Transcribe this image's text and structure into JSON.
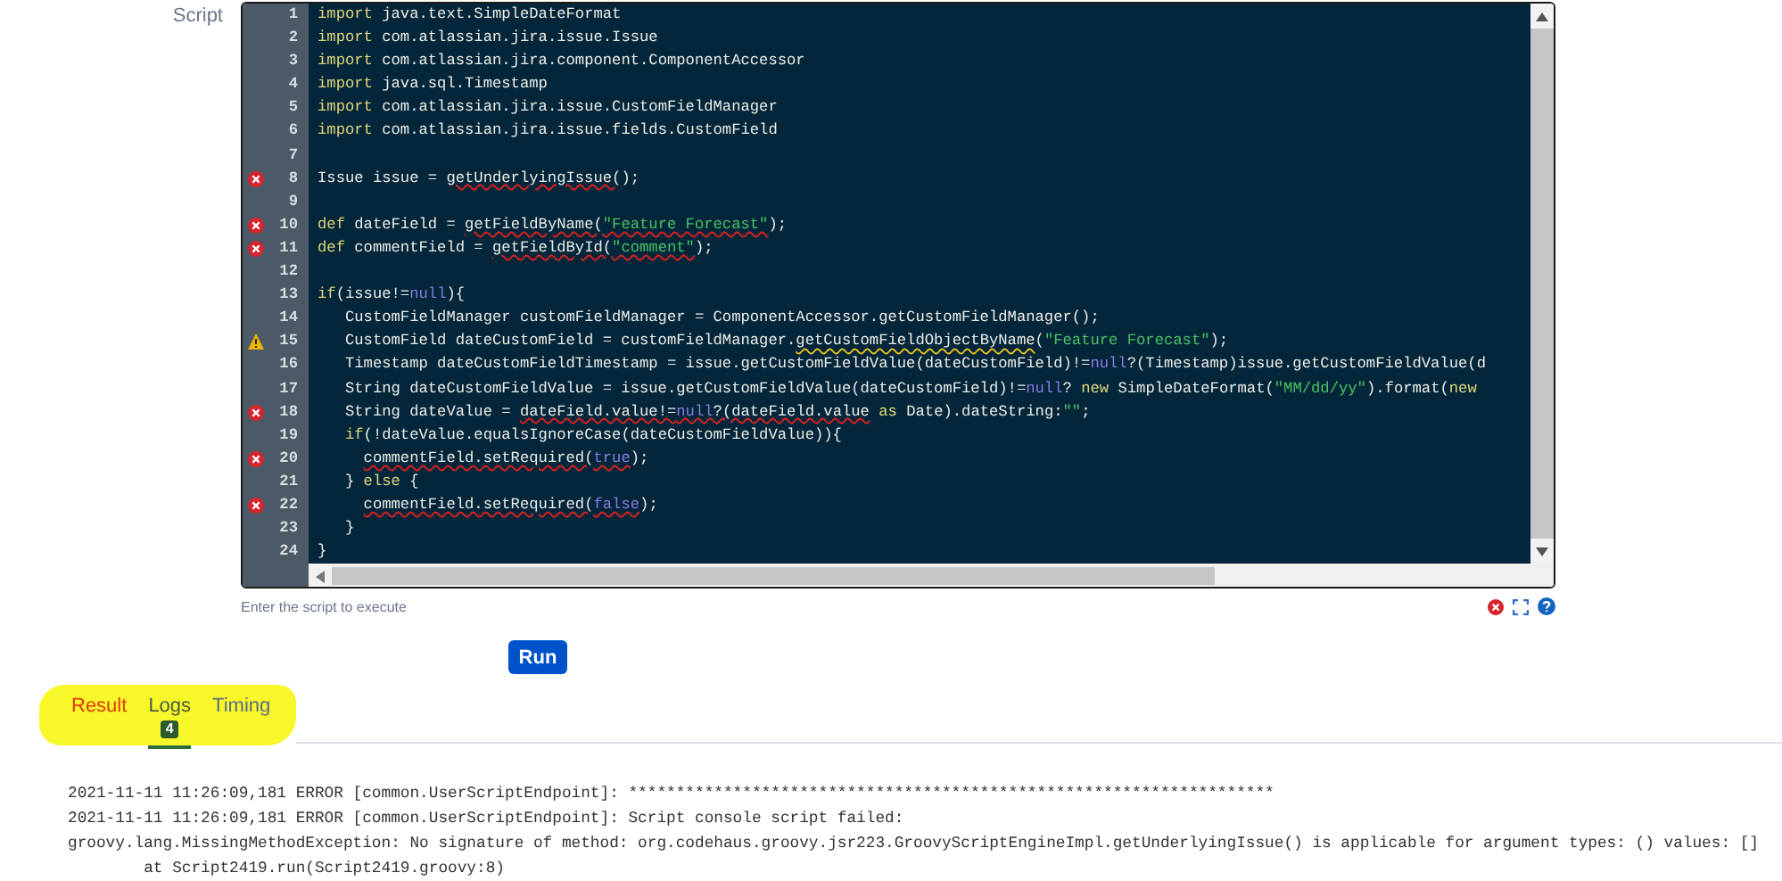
{
  "script_label": "Script",
  "editor": {
    "lines": [
      {
        "number": "1",
        "error": false,
        "warning": false,
        "tokens": [
          {
            "kind": "keyword",
            "text": "import"
          },
          {
            "kind": "plain",
            "text": " java.text.SimpleDateFormat"
          }
        ]
      },
      {
        "number": "2",
        "error": false,
        "warning": false,
        "tokens": [
          {
            "kind": "keyword",
            "text": "import"
          },
          {
            "kind": "plain",
            "text": " com.atlassian.jira.issue.Issue"
          }
        ]
      },
      {
        "number": "3",
        "error": false,
        "warning": false,
        "tokens": [
          {
            "kind": "keyword",
            "text": "import"
          },
          {
            "kind": "plain",
            "text": " com.atlassian.jira.component.ComponentAccessor"
          }
        ]
      },
      {
        "number": "4",
        "error": false,
        "warning": false,
        "tokens": [
          {
            "kind": "keyword",
            "text": "import"
          },
          {
            "kind": "plain",
            "text": " java.sql.Timestamp"
          }
        ]
      },
      {
        "number": "5",
        "error": false,
        "warning": false,
        "tokens": [
          {
            "kind": "keyword",
            "text": "import"
          },
          {
            "kind": "plain",
            "text": " com.atlassian.jira.issue.CustomFieldManager"
          }
        ]
      },
      {
        "number": "6",
        "error": false,
        "warning": false,
        "tokens": [
          {
            "kind": "keyword",
            "text": "import"
          },
          {
            "kind": "plain",
            "text": " com.atlassian.jira.issue.fields.CustomField"
          }
        ]
      },
      {
        "number": "7",
        "error": false,
        "warning": false
      },
      {
        "number": "8",
        "error": true,
        "warning": false,
        "tokens": [
          {
            "kind": "plain",
            "text": "Issue issue = "
          },
          {
            "kind": "plain",
            "text": "getUnderlyingIssue(",
            "error": true
          },
          {
            "kind": "plain",
            "text": ");"
          }
        ]
      },
      {
        "number": "9",
        "error": false,
        "warning": false
      },
      {
        "number": "10",
        "error": true,
        "warning": false,
        "tokens": [
          {
            "kind": "keyword",
            "text": "def"
          },
          {
            "kind": "plain",
            "text": " dateField = "
          },
          {
            "kind": "plain",
            "text": "getFieldByName(",
            "error": true
          },
          {
            "kind": "string",
            "text": "\"Feature Forecast\"",
            "error": true
          },
          {
            "kind": "plain",
            "text": ");"
          }
        ]
      },
      {
        "number": "11",
        "error": true,
        "warning": false,
        "tokens": [
          {
            "kind": "keyword",
            "text": "def"
          },
          {
            "kind": "plain",
            "text": " commentField = "
          },
          {
            "kind": "plain",
            "text": "getFieldById(",
            "error": true
          },
          {
            "kind": "string",
            "text": "\"comment\"",
            "error": true
          },
          {
            "kind": "plain",
            "text": ");"
          }
        ]
      },
      {
        "number": "12",
        "error": false,
        "warning": false
      },
      {
        "number": "13",
        "error": false,
        "warning": false,
        "tokens": [
          {
            "kind": "keyword",
            "text": "if"
          },
          {
            "kind": "plain",
            "text": "(issue!="
          },
          {
            "kind": "literal",
            "text": "null"
          },
          {
            "kind": "plain",
            "text": "){"
          }
        ]
      },
      {
        "number": "14",
        "error": false,
        "warning": false,
        "tokens": [
          {
            "kind": "plain",
            "text": "   CustomFieldManager customFieldManager = ComponentAccessor.getCustomFieldManager();"
          }
        ]
      },
      {
        "number": "15",
        "error": false,
        "warning": true,
        "tokens": [
          {
            "kind": "plain",
            "text": "   CustomField dateCustomField = customFieldManager."
          },
          {
            "kind": "plain",
            "text": "getCustomFieldObjectByName",
            "warning": true
          },
          {
            "kind": "plain",
            "text": "("
          },
          {
            "kind": "string",
            "text": "\"Feature Forecast\""
          },
          {
            "kind": "plain",
            "text": ");"
          }
        ]
      },
      {
        "number": "16",
        "error": false,
        "warning": false,
        "tokens": [
          {
            "kind": "plain",
            "text": "   Timestamp dateCustomFieldTimestamp = issue.getCustomFieldValue(dateCustomField)!="
          },
          {
            "kind": "literal",
            "text": "null"
          },
          {
            "kind": "plain",
            "text": "?(Timestamp)issue.getCustomFieldValue(d"
          }
        ]
      },
      {
        "number": "17",
        "error": false,
        "warning": false,
        "tokens": [
          {
            "kind": "plain",
            "text": "   String dateCustomFieldValue = issue.getCustomFieldValue(dateCustomField)!="
          },
          {
            "kind": "literal",
            "text": "null"
          },
          {
            "kind": "plain",
            "text": "? "
          },
          {
            "kind": "keyword",
            "text": "new"
          },
          {
            "kind": "plain",
            "text": " SimpleDateFormat("
          },
          {
            "kind": "string",
            "text": "\"MM/dd/yy\""
          },
          {
            "kind": "plain",
            "text": ").format("
          },
          {
            "kind": "keyword",
            "text": "new"
          }
        ]
      },
      {
        "number": "18",
        "error": true,
        "warning": false,
        "tokens": [
          {
            "kind": "plain",
            "text": "   String dateValue = "
          },
          {
            "kind": "plain",
            "text": "dateField.value!=",
            "error": true
          },
          {
            "kind": "literal",
            "text": "null",
            "error": true
          },
          {
            "kind": "plain",
            "text": "?(dateField.value",
            "error": true
          },
          {
            "kind": "keyword",
            "text": " as"
          },
          {
            "kind": "plain",
            "text": " Date).dateString:"
          },
          {
            "kind": "string",
            "text": "\"\""
          },
          {
            "kind": "plain",
            "text": ";"
          }
        ]
      },
      {
        "number": "19",
        "error": false,
        "warning": false,
        "tokens": [
          {
            "kind": "keyword",
            "text": "   if"
          },
          {
            "kind": "plain",
            "text": "(!dateValue.equalsIgnoreCase(dateCustomFieldValue)){"
          }
        ]
      },
      {
        "number": "20",
        "error": true,
        "warning": false,
        "tokens": [
          {
            "kind": "plain",
            "text": "     commentField.setRequired(",
            "error": true
          },
          {
            "kind": "literal",
            "text": "true",
            "error": true
          },
          {
            "kind": "plain",
            "text": ");"
          }
        ]
      },
      {
        "number": "21",
        "error": false,
        "warning": false,
        "tokens": [
          {
            "kind": "plain",
            "text": "   } "
          },
          {
            "kind": "keyword",
            "text": "else"
          },
          {
            "kind": "plain",
            "text": " {"
          }
        ]
      },
      {
        "number": "22",
        "error": true,
        "warning": false,
        "tokens": [
          {
            "kind": "plain",
            "text": "     commentField.setRequired(",
            "error": true
          },
          {
            "kind": "literal",
            "text": "false",
            "error": true
          },
          {
            "kind": "plain",
            "text": ");"
          }
        ]
      },
      {
        "number": "23",
        "error": false,
        "warning": false,
        "tokens": [
          {
            "kind": "plain",
            "text": "   }"
          }
        ]
      },
      {
        "number": "24",
        "error": false,
        "warning": false,
        "tokens": [
          {
            "kind": "plain",
            "text": "}"
          }
        ]
      }
    ],
    "hint": "Enter the script to execute"
  },
  "run_button": "Run",
  "tabs": [
    {
      "label": "Result",
      "selected": false,
      "error": true
    },
    {
      "label": "Logs",
      "selected": true,
      "error": false,
      "badge": "4"
    },
    {
      "label": "Timing",
      "selected": false,
      "error": false
    }
  ],
  "log": {
    "lines": [
      "2021-11-11 11:26:09,181 ERROR [common.UserScriptEndpoint]: ********************************************************************",
      "2021-11-11 11:26:09,181 ERROR [common.UserScriptEndpoint]: Script console script failed:",
      "groovy.lang.MissingMethodException: No signature of method: org.codehaus.groovy.jsr223.GroovyScriptEngineImpl.getUnderlyingIssue() is applicable for argument types: () values: []",
      "        at Script2419.run(Script2419.groovy:8)"
    ]
  }
}
